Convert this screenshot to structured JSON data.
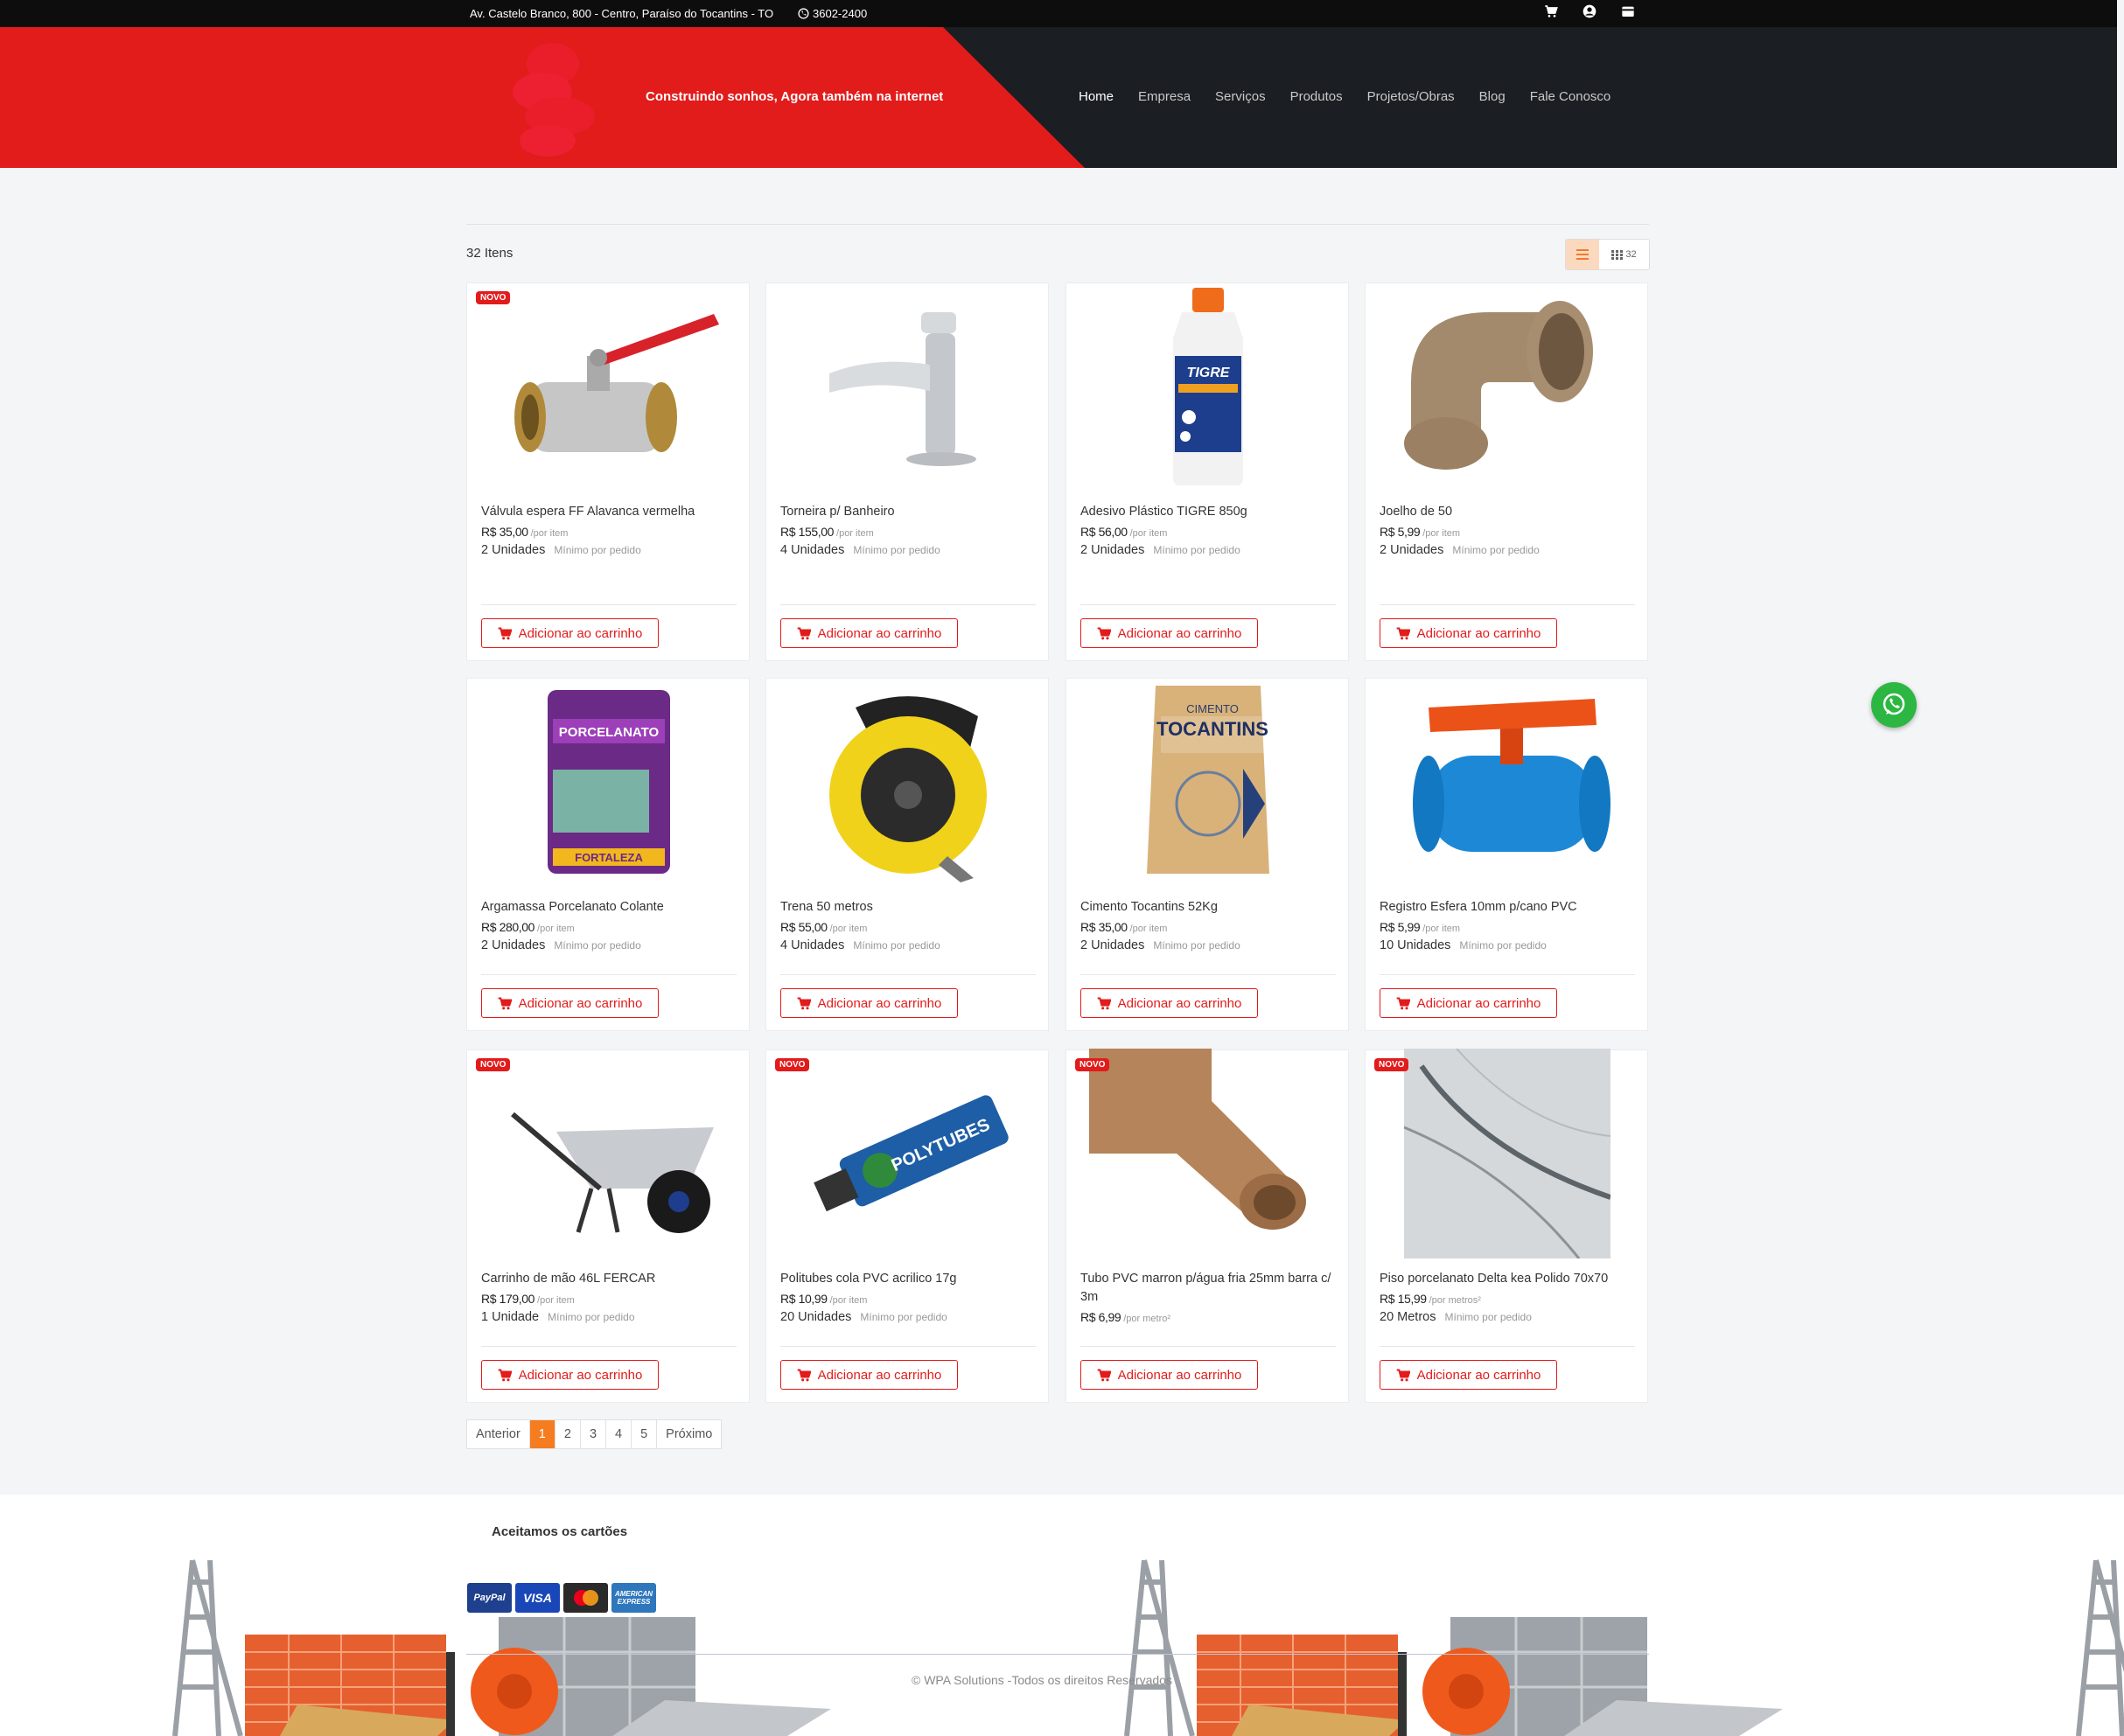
{
  "topbar": {
    "address": "Av. Castelo Branco, 800 - Centro, Paraíso do Tocantins - TO",
    "phone": "3602-2400",
    "icons": [
      "cart-icon",
      "user-icon",
      "store-icon"
    ]
  },
  "header": {
    "slogan": "Construindo sonhos, Agora também na internet",
    "nav": [
      "Home",
      "Empresa",
      "Serviços",
      "Produtos",
      "Projetos/Obras",
      "Blog",
      "Fale Conosco"
    ],
    "active_nav": "Home",
    "brand_red": "#e21b1b",
    "dark_bg": "#1b1e22"
  },
  "listing": {
    "count_label": "32 Itens",
    "per_page": "32",
    "add_label": "Adicionar ao carrinho",
    "badge_label": "NOVO",
    "min_label": "Mínimo por pedido",
    "products": [
      {
        "name": "Válvula espera FF Alavanca vermelha",
        "price": "R$ 35,00",
        "unit": "/por item",
        "qty": "2 Unidades",
        "new": true,
        "icon": "valve-icon"
      },
      {
        "name": "Torneira p/ Banheiro",
        "price": "R$ 155,00",
        "unit": "/por item",
        "qty": "4 Unidades",
        "new": false,
        "icon": "faucet-icon"
      },
      {
        "name": "Adesivo Plástico TIGRE 850g",
        "price": "R$ 56,00",
        "unit": "/por item",
        "qty": "2 Unidades",
        "new": false,
        "icon": "adhesive-bottle-icon"
      },
      {
        "name": "Joelho de 50",
        "price": "R$ 5,99",
        "unit": "/por item",
        "qty": "2 Unidades",
        "new": false,
        "icon": "pipe-elbow-icon"
      },
      {
        "name": "Argamassa Porcelanato Colante",
        "price": "R$ 280,00",
        "unit": "/por item",
        "qty": "2 Unidades",
        "new": false,
        "icon": "mortar-bag-icon",
        "bag_title": "PORCELANATO",
        "bag_brand": "FORTALEZA"
      },
      {
        "name": "Trena 50 metros",
        "price": "R$ 55,00",
        "unit": "/por item",
        "qty": "4 Unidades",
        "new": false,
        "icon": "measuring-tape-icon"
      },
      {
        "name": "Cimento Tocantins 52Kg",
        "price": "R$ 35,00",
        "unit": "/por item",
        "qty": "2 Unidades",
        "new": false,
        "icon": "cement-bag-icon",
        "bag_title": "CIMENTO",
        "bag_brand": "TOCANTINS"
      },
      {
        "name": "Registro Esfera 10mm p/cano PVC",
        "price": "R$ 5,99",
        "unit": "/por item",
        "qty": "10 Unidades",
        "new": false,
        "icon": "ball-valve-icon"
      },
      {
        "name": "Carrinho de mão 46L FERCAR",
        "price": "R$ 179,00",
        "unit": "/por item",
        "qty": "1 Unidade",
        "new": true,
        "icon": "wheelbarrow-icon"
      },
      {
        "name": "Politubes cola PVC acrilico 17g",
        "price": "R$ 10,99",
        "unit": "/por item",
        "qty": "20 Unidades",
        "new": true,
        "icon": "glue-tube-icon",
        "tube_label": "POLYTUBES"
      },
      {
        "name": "Tubo PVC marron p/água fria 25mm barra c/ 3m",
        "price": "R$ 6,99",
        "unit": "/por metro²",
        "qty": "",
        "new": true,
        "icon": "pvc-pipe-icon"
      },
      {
        "name": "Piso porcelanato Delta kea Polido 70x70",
        "price": "R$ 15,99",
        "unit": "/por metros²",
        "qty": "20 Metros",
        "new": true,
        "icon": "marble-tile-icon"
      }
    ]
  },
  "pagination": {
    "prev": "Anterior",
    "pages": [
      "1",
      "2",
      "3",
      "4",
      "5"
    ],
    "current": "1",
    "next": "Próximo",
    "accent": "#f57c1f"
  },
  "footer": {
    "cards_title": "Aceitamos os cartões",
    "cards": [
      "PayPal",
      "VISA",
      "Mastercard",
      "AMERICAN EXPRESS"
    ],
    "copyright": "© WPA Solutions -Todos os direitos Reservados"
  }
}
